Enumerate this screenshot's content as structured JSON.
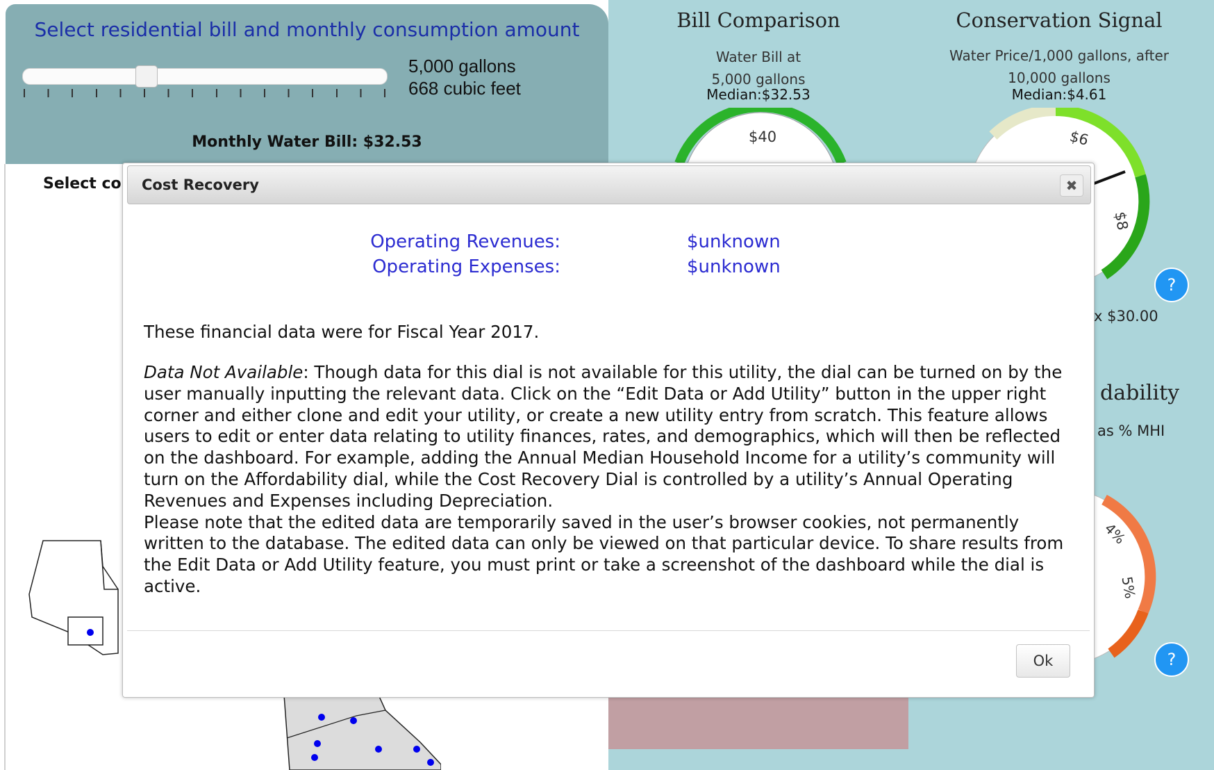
{
  "consumption_panel": {
    "title": "Select residential bill and monthly consumption amount",
    "slider_value": 0.33,
    "gallons": "5,000 gallons",
    "cubic_feet": "668 cubic feet",
    "monthly_bill": "Monthly Water Bill: $32.53"
  },
  "select_label": "Select co",
  "bill_comparison": {
    "title": "Bill Comparison",
    "subtitle_line1": "Water Bill at",
    "subtitle_line2": "5,000 gallons",
    "median": "Median:$32.53",
    "gauge_label": "$40"
  },
  "conservation_signal": {
    "title": "Conservation Signal",
    "subtitle_line1": "Water Price/1,000 gallons, after",
    "subtitle_line2": "10,000 gallons",
    "median": "Median:$4.61",
    "gauge_labels": [
      "$6",
      "$8"
    ],
    "max_label": "x $30.00"
  },
  "affordability": {
    "title_fragment": "dability",
    "subtitle_fragment": "as % MHI",
    "gauge_labels": [
      "4%",
      "5%"
    ]
  },
  "help_label": "?",
  "modal": {
    "title": "Cost Recovery",
    "close_symbol": "✖",
    "revenues_label": "Operating Revenues:",
    "revenues_value": "$unknown",
    "expenses_label": "Operating Expenses:",
    "expenses_value": "$unknown",
    "fiscal_year_text": "These financial data were for Fiscal Year 2017.",
    "na_title": "Data Not Available",
    "na_body": ": Though data for this dial is not available for this utility, the dial can be turned on by the user manually inputting the relevant data. Click on the “Edit Data or Add Utility” button in the upper right corner and either clone and edit your utility, or create a new utility entry from scratch. This feature allows users to edit or enter data relating to utility finances, rates, and demographics, which will then be reflected on the dashboard. For example, adding the Annual Median Household Income for a utility’s community will turn on the Affordability dial, while the Cost Recovery Dial is controlled by a utility’s Annual Operating Revenues and Expenses including Depreciation.",
    "note_body": "Please note that the edited data are temporarily saved in the user’s browser cookies, not permanently written to the database. The edited data can only be viewed on that particular device. To share results from the Edit Data or Add Utility feature, you must print or take a screenshot of the dashboard while the dial is active.",
    "ok_label": "Ok"
  }
}
